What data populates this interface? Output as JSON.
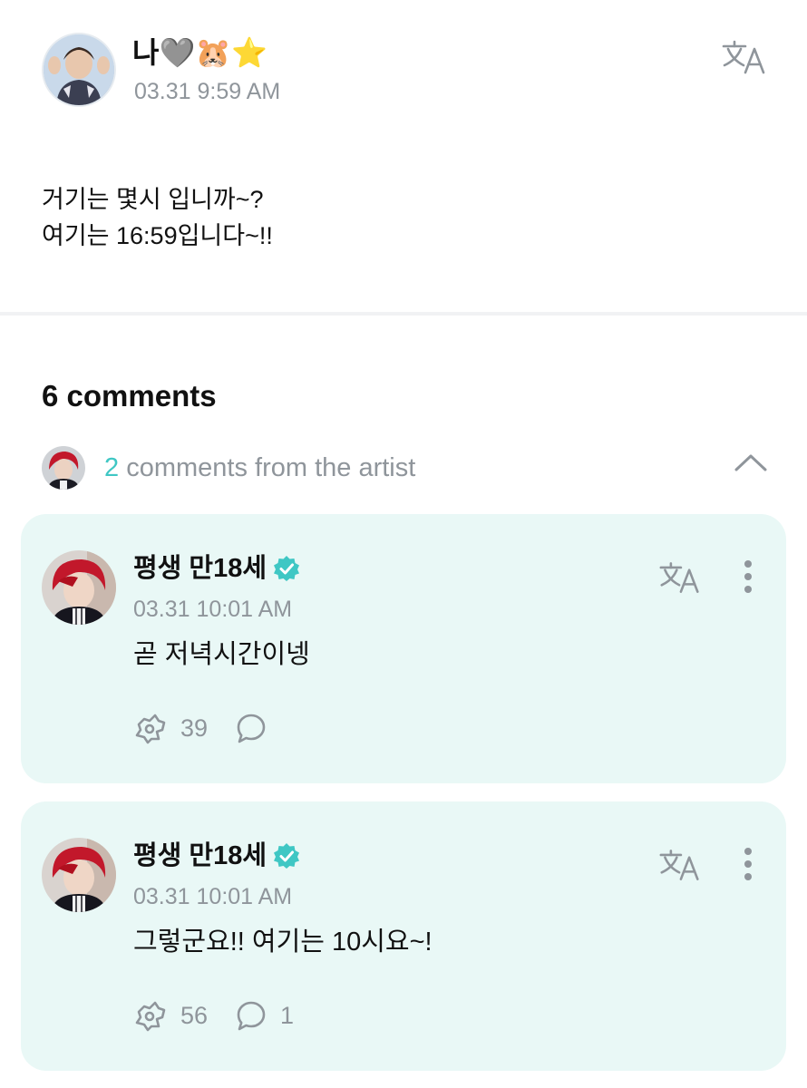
{
  "post": {
    "author_name": "나🩶🐹⭐",
    "timestamp": "03.31 9:59 AM",
    "body_lines": [
      "거기는 몇시 입니까~?",
      "여기는 16:59입니다~!!"
    ]
  },
  "comments_section": {
    "count_label": "6 comments",
    "artist_count": "2",
    "artist_label": "comments from the artist"
  },
  "comments": [
    {
      "author": "평생 만18세",
      "timestamp": "03.31 10:01 AM",
      "text": "곧 저녁시간이넹",
      "likes": "39",
      "replies": ""
    },
    {
      "author": "평생 만18세",
      "timestamp": "03.31 10:01 AM",
      "text": "그렇군요!! 여기는 10시요~!",
      "likes": "56",
      "replies": "1"
    }
  ],
  "colors": {
    "accent": "#3fc7c4",
    "card_bg": "#e9f8f6",
    "muted_text": "#8f959b"
  },
  "icons": [
    "translate-icon",
    "chevron-up-icon",
    "more-vertical-icon",
    "like-icon",
    "reply-icon",
    "verified-badge-icon"
  ]
}
